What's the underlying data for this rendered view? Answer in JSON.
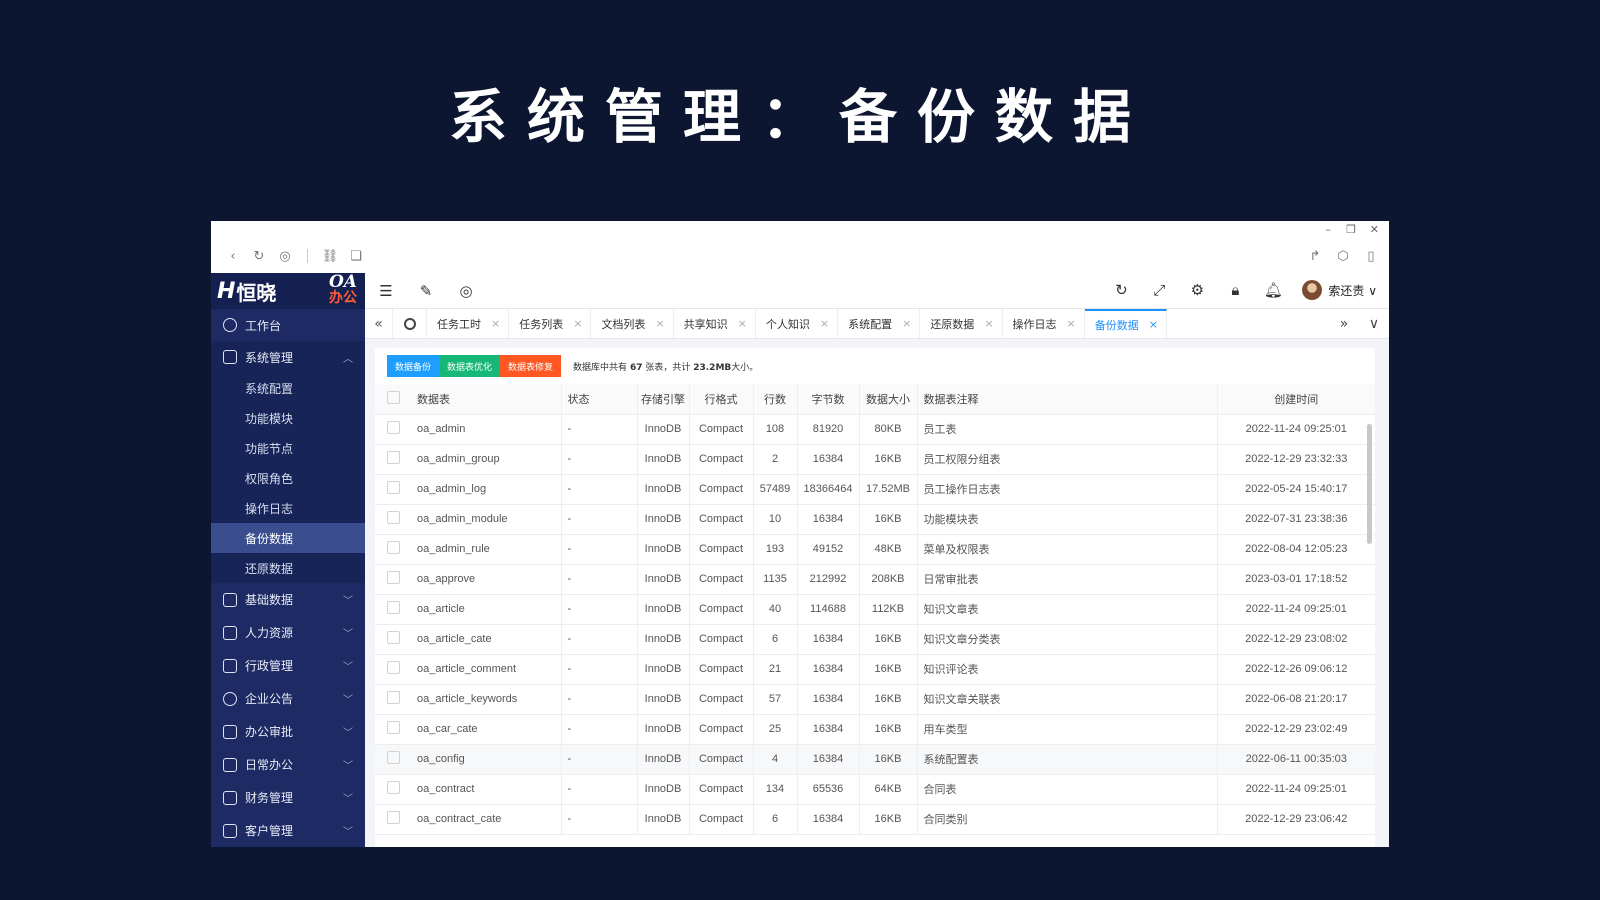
{
  "headline": "系统管理：备份数据",
  "window": {
    "minimize": "–",
    "restore": "❐",
    "close": "✕"
  },
  "logo": {
    "mark": "H",
    "name": "恒晓",
    "oa": "OA",
    "badge": "办公"
  },
  "sidebar": {
    "items": [
      {
        "label": "工作台"
      },
      {
        "label": "系统管理",
        "open": true,
        "sub": [
          "系统配置",
          "功能模块",
          "功能节点",
          "权限角色",
          "操作日志",
          "备份数据",
          "还原数据"
        ],
        "active": "备份数据"
      },
      {
        "label": "基础数据"
      },
      {
        "label": "人力资源"
      },
      {
        "label": "行政管理"
      },
      {
        "label": "企业公告"
      },
      {
        "label": "办公审批"
      },
      {
        "label": "日常办公"
      },
      {
        "label": "财务管理"
      },
      {
        "label": "客户管理"
      }
    ]
  },
  "topbar": {
    "user": "索还责"
  },
  "tabs": [
    "任务工时",
    "任务列表",
    "文档列表",
    "共享知识",
    "个人知识",
    "系统配置",
    "还原数据",
    "操作日志",
    "备份数据"
  ],
  "active_tab": "备份数据",
  "toolbar": {
    "backup": "数据备份",
    "optimize": "数据表优化",
    "repair": "数据表修复",
    "summary_prefix": "数据库中共有",
    "table_count": "67",
    "summary_mid": "张表，共计",
    "total_size": "23.2MB",
    "summary_suffix": "大小。"
  },
  "table": {
    "headers": [
      "数据表",
      "状态",
      "存储引擎",
      "行格式",
      "行数",
      "字节数",
      "数据大小",
      "数据表注释",
      "创建时间"
    ],
    "rows": [
      [
        "oa_admin",
        "-",
        "InnoDB",
        "Compact",
        "108",
        "81920",
        "80KB",
        "员工表",
        "2022-11-24 09:25:01"
      ],
      [
        "oa_admin_group",
        "-",
        "InnoDB",
        "Compact",
        "2",
        "16384",
        "16KB",
        "员工权限分组表",
        "2022-12-29 23:32:33"
      ],
      [
        "oa_admin_log",
        "-",
        "InnoDB",
        "Compact",
        "57489",
        "18366464",
        "17.52MB",
        "员工操作日志表",
        "2022-05-24 15:40:17"
      ],
      [
        "oa_admin_module",
        "-",
        "InnoDB",
        "Compact",
        "10",
        "16384",
        "16KB",
        "功能模块表",
        "2022-07-31 23:38:36"
      ],
      [
        "oa_admin_rule",
        "-",
        "InnoDB",
        "Compact",
        "193",
        "49152",
        "48KB",
        "菜单及权限表",
        "2022-08-04 12:05:23"
      ],
      [
        "oa_approve",
        "-",
        "InnoDB",
        "Compact",
        "1135",
        "212992",
        "208KB",
        "日常审批表",
        "2023-03-01 17:18:52"
      ],
      [
        "oa_article",
        "-",
        "InnoDB",
        "Compact",
        "40",
        "114688",
        "112KB",
        "知识文章表",
        "2022-11-24 09:25:01"
      ],
      [
        "oa_article_cate",
        "-",
        "InnoDB",
        "Compact",
        "6",
        "16384",
        "16KB",
        "知识文章分类表",
        "2022-12-29 23:08:02"
      ],
      [
        "oa_article_comment",
        "-",
        "InnoDB",
        "Compact",
        "21",
        "16384",
        "16KB",
        "知识评论表",
        "2022-12-26 09:06:12"
      ],
      [
        "oa_article_keywords",
        "-",
        "InnoDB",
        "Compact",
        "57",
        "16384",
        "16KB",
        "知识文章关联表",
        "2022-06-08 21:20:17"
      ],
      [
        "oa_car_cate",
        "-",
        "InnoDB",
        "Compact",
        "25",
        "16384",
        "16KB",
        "用车类型",
        "2022-12-29 23:02:49"
      ],
      [
        "oa_config",
        "-",
        "InnoDB",
        "Compact",
        "4",
        "16384",
        "16KB",
        "系统配置表",
        "2022-06-11 00:35:03"
      ],
      [
        "oa_contract",
        "-",
        "InnoDB",
        "Compact",
        "134",
        "65536",
        "64KB",
        "合同表",
        "2022-11-24 09:25:01"
      ],
      [
        "oa_contract_cate",
        "-",
        "InnoDB",
        "Compact",
        "6",
        "16384",
        "16KB",
        "合同类别",
        "2022-12-29 23:06:42"
      ]
    ]
  }
}
